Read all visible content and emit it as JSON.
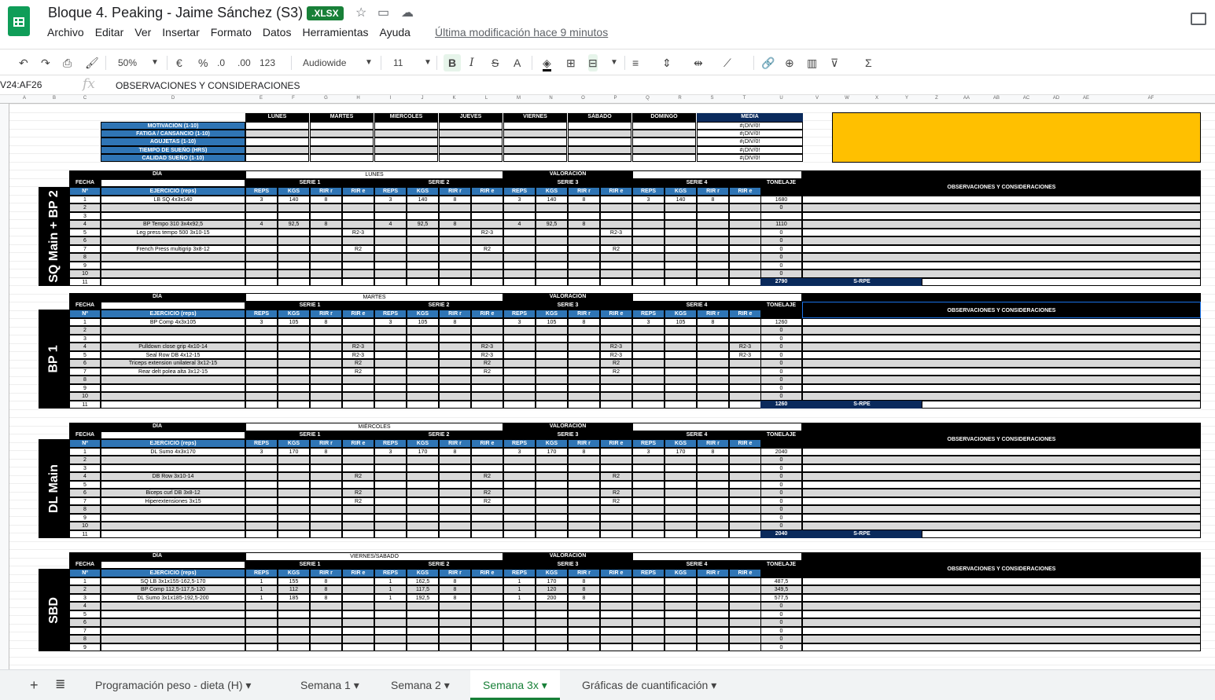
{
  "doc": {
    "title": "Bloque 4. Peaking - Jaime Sánchez (S3)",
    "badge": ".XLSX",
    "last_edit": "Última modificación hace 9 minutos"
  },
  "menu": [
    "Archivo",
    "Editar",
    "Ver",
    "Insertar",
    "Formato",
    "Datos",
    "Herramientas",
    "Ayuda"
  ],
  "toolbar": {
    "zoom": "50%",
    "currency": "€",
    "percent": "%",
    "dec_less": ".0",
    "dec_more": ".00",
    "format": "123",
    "font": "Audiowide",
    "size": "11"
  },
  "formulabar": {
    "namebox": "V24:AF26",
    "fx": "fx",
    "formula": "OBSERVACIONES Y CONSIDERACIONES"
  },
  "columns": [
    "A",
    "B",
    "C",
    "D",
    "E",
    "F",
    "G",
    "H",
    "I",
    "J",
    "K",
    "L",
    "M",
    "N",
    "O",
    "P",
    "Q",
    "R",
    "S",
    "T",
    "U",
    "V",
    "W",
    "X",
    "Y",
    "Z",
    "AA",
    "AB",
    "AC",
    "AD",
    "AE",
    "AF"
  ],
  "summary": {
    "days": [
      "LUNES",
      "MARTES",
      "MIERCOLES",
      "JUEVES",
      "VIERNES",
      "SÁBADO",
      "DOMINGO",
      "MEDIA"
    ],
    "rows": [
      "MOTIVACIÓN (1-10)",
      "FATIGA / CANSANCIO (1-10)",
      "AGUJETAS (1-10)",
      "TIEMPO DE SUEÑO (HRS)",
      "CALIDAD SUEÑO (1-10)"
    ],
    "media": "#¡DIV/0!"
  },
  "labels": {
    "dia": "DÍA",
    "fecha": "FECHA",
    "n": "Nº",
    "ejercicio": "EJERCICIO (reps)",
    "valoracion": "VALORACIÓN",
    "serie1": "SERIE 1",
    "serie2": "SERIE 2",
    "serie3": "SERIE 3",
    "serie4": "SERIE 4",
    "reps": "REPS",
    "kgs": "KGS",
    "rirr": "RIR r",
    "rire": "RIR e",
    "tonelaje": "TONELAJE",
    "obs": "OBSERVACIONES Y CONSIDERACIONES",
    "srpe": "S-RPE"
  },
  "blocks": [
    {
      "side": "SQ Main + BP 2",
      "day": "LUNES",
      "total": "2790",
      "rows": [
        {
          "n": "1",
          "ex": "LB SQ 4x3x140",
          "s": [
            [
              "3",
              "140",
              "8",
              ""
            ],
            [
              "3",
              "140",
              "8",
              ""
            ],
            [
              "3",
              "140",
              "8",
              ""
            ],
            [
              "3",
              "140",
              "8",
              ""
            ]
          ],
          "t": "1680"
        },
        {
          "n": "2",
          "ex": "",
          "s": [],
          "t": "0"
        },
        {
          "n": "3",
          "ex": "",
          "s": [],
          "t": ""
        },
        {
          "n": "4",
          "ex": "BP Tempo 310 3x4x92,5",
          "s": [
            [
              "4",
              "92,5",
              "8",
              ""
            ],
            [
              "4",
              "92,5",
              "8",
              ""
            ],
            [
              "4",
              "92,5",
              "8",
              ""
            ],
            [
              "",
              "",
              "",
              ""
            ]
          ],
          "t": "1110"
        },
        {
          "n": "5",
          "ex": "Leg press tempo 500 3x10-15",
          "s": [
            [
              "",
              "",
              "",
              "R2-3"
            ],
            [
              "",
              "",
              "",
              "R2-3"
            ],
            [
              "",
              "",
              "",
              "R2-3"
            ],
            [
              "",
              "",
              "",
              ""
            ]
          ],
          "t": "0"
        },
        {
          "n": "6",
          "ex": "",
          "s": [],
          "t": "0"
        },
        {
          "n": "7",
          "ex": "French Press multigrip 3x8-12",
          "s": [
            [
              "",
              "",
              "",
              "R2"
            ],
            [
              "",
              "",
              "",
              "R2"
            ],
            [
              "",
              "",
              "",
              "R2"
            ],
            [
              "",
              "",
              "",
              ""
            ]
          ],
          "t": "0"
        },
        {
          "n": "8",
          "ex": "",
          "s": [],
          "t": "0"
        },
        {
          "n": "9",
          "ex": "",
          "s": [],
          "t": "0"
        },
        {
          "n": "10",
          "ex": "",
          "s": [],
          "t": "0"
        },
        {
          "n": "11",
          "ex": "",
          "s": [],
          "t": "2790"
        }
      ]
    },
    {
      "side": "BP 1",
      "day": "MARTES",
      "total": "1260",
      "rows": [
        {
          "n": "1",
          "ex": "BP Comp 4x3x105",
          "s": [
            [
              "3",
              "105",
              "8",
              ""
            ],
            [
              "3",
              "105",
              "8",
              ""
            ],
            [
              "3",
              "105",
              "8",
              ""
            ],
            [
              "3",
              "105",
              "8",
              ""
            ]
          ],
          "t": "1260"
        },
        {
          "n": "2",
          "ex": "",
          "s": [],
          "t": "0"
        },
        {
          "n": "3",
          "ex": "",
          "s": [],
          "t": "0"
        },
        {
          "n": "4",
          "ex": "Pulldown close grip 4x10-14",
          "s": [
            [
              "",
              "",
              "",
              "R2-3"
            ],
            [
              "",
              "",
              "",
              "R2-3"
            ],
            [
              "",
              "",
              "",
              "R2-3"
            ],
            [
              "",
              "",
              "",
              "R2-3"
            ]
          ],
          "t": "0"
        },
        {
          "n": "5",
          "ex": "Seal Row DB 4x12-15",
          "s": [
            [
              "",
              "",
              "",
              "R2-3"
            ],
            [
              "",
              "",
              "",
              "R2-3"
            ],
            [
              "",
              "",
              "",
              "R2-3"
            ],
            [
              "",
              "",
              "",
              "R2-3"
            ]
          ],
          "t": "0"
        },
        {
          "n": "6",
          "ex": "Triceps extension unilateral 3x12-15",
          "s": [
            [
              "",
              "",
              "",
              "R2"
            ],
            [
              "",
              "",
              "",
              "R2"
            ],
            [
              "",
              "",
              "",
              "R2"
            ],
            [
              "",
              "",
              "",
              ""
            ]
          ],
          "t": "0"
        },
        {
          "n": "7",
          "ex": "Rear delt polea alta 3x12-15",
          "s": [
            [
              "",
              "",
              "",
              "R2"
            ],
            [
              "",
              "",
              "",
              "R2"
            ],
            [
              "",
              "",
              "",
              "R2"
            ],
            [
              "",
              "",
              "",
              ""
            ]
          ],
          "t": "0"
        },
        {
          "n": "8",
          "ex": "",
          "s": [],
          "t": "0"
        },
        {
          "n": "9",
          "ex": "",
          "s": [],
          "t": "0"
        },
        {
          "n": "10",
          "ex": "",
          "s": [],
          "t": "0"
        },
        {
          "n": "11",
          "ex": "",
          "s": [],
          "t": "1260"
        }
      ]
    },
    {
      "side": "DL Main",
      "day": "MIÉRCOLES",
      "total": "2040",
      "rows": [
        {
          "n": "1",
          "ex": "DL Sumo 4x3x170",
          "s": [
            [
              "3",
              "170",
              "8",
              ""
            ],
            [
              "3",
              "170",
              "8",
              ""
            ],
            [
              "3",
              "170",
              "8",
              ""
            ],
            [
              "3",
              "170",
              "8",
              ""
            ]
          ],
          "t": "2040"
        },
        {
          "n": "2",
          "ex": "",
          "s": [],
          "t": "0"
        },
        {
          "n": "3",
          "ex": "",
          "s": [],
          "t": "0"
        },
        {
          "n": "4",
          "ex": "DB Row 3x10-14",
          "s": [
            [
              "",
              "",
              "",
              "R2"
            ],
            [
              "",
              "",
              "",
              "R2"
            ],
            [
              "",
              "",
              "",
              "R2"
            ],
            [
              "",
              "",
              "",
              ""
            ]
          ],
          "t": "0"
        },
        {
          "n": "5",
          "ex": "",
          "s": [],
          "t": "0"
        },
        {
          "n": "6",
          "ex": "Biceps curl DB 3x8-12",
          "s": [
            [
              "",
              "",
              "",
              "R2"
            ],
            [
              "",
              "",
              "",
              "R2"
            ],
            [
              "",
              "",
              "",
              "R2"
            ],
            [
              "",
              "",
              "",
              ""
            ]
          ],
          "t": "0"
        },
        {
          "n": "7",
          "ex": "Hiperextensiones 3x15",
          "s": [
            [
              "",
              "",
              "",
              "R2"
            ],
            [
              "",
              "",
              "",
              "R2"
            ],
            [
              "",
              "",
              "",
              "R2"
            ],
            [
              "",
              "",
              "",
              ""
            ]
          ],
          "t": "0"
        },
        {
          "n": "8",
          "ex": "",
          "s": [],
          "t": "0"
        },
        {
          "n": "9",
          "ex": "",
          "s": [],
          "t": "0"
        },
        {
          "n": "10",
          "ex": "",
          "s": [],
          "t": "0"
        },
        {
          "n": "11",
          "ex": "",
          "s": [],
          "t": "2040"
        }
      ]
    },
    {
      "side": "SBD",
      "day": "VIERNES/SABADO",
      "total": "",
      "rows": [
        {
          "n": "1",
          "ex": "SQ LB 3x1x155-162,5-170",
          "s": [
            [
              "1",
              "155",
              "8",
              ""
            ],
            [
              "1",
              "162,5",
              "8",
              ""
            ],
            [
              "1",
              "170",
              "8",
              ""
            ],
            [
              "",
              "",
              "",
              ""
            ]
          ],
          "t": "487,5"
        },
        {
          "n": "2",
          "ex": "BP Comp 112,5-117,5-120",
          "s": [
            [
              "1",
              "112",
              "8",
              ""
            ],
            [
              "1",
              "117,5",
              "8",
              ""
            ],
            [
              "1",
              "120",
              "8",
              ""
            ],
            [
              "",
              "",
              "",
              ""
            ]
          ],
          "t": "349,5"
        },
        {
          "n": "3",
          "ex": "DL Sumo 3x1x185-192,5-200",
          "s": [
            [
              "1",
              "185",
              "8",
              ""
            ],
            [
              "1",
              "192,5",
              "8",
              ""
            ],
            [
              "1",
              "200",
              "8",
              ""
            ],
            [
              "",
              "",
              "",
              ""
            ]
          ],
          "t": "577,5"
        },
        {
          "n": "4",
          "ex": "",
          "s": [],
          "t": "0"
        },
        {
          "n": "5",
          "ex": "",
          "s": [],
          "t": "0"
        },
        {
          "n": "6",
          "ex": "",
          "s": [],
          "t": "0"
        },
        {
          "n": "7",
          "ex": "",
          "s": [],
          "t": "0"
        },
        {
          "n": "8",
          "ex": "",
          "s": [],
          "t": "0"
        },
        {
          "n": "9",
          "ex": "",
          "s": [],
          "t": "0"
        }
      ]
    }
  ],
  "sheet_tabs": [
    {
      "label": "Programación peso - dieta (H)",
      "active": false
    },
    {
      "label": "Semana 1",
      "active": false
    },
    {
      "label": "Semana 2",
      "active": false
    },
    {
      "label": "Semana 3x",
      "active": true
    },
    {
      "label": "Gráficas de cuantificación",
      "active": false
    }
  ],
  "colors": {
    "accent": "#188038",
    "header_blue": "#2f75b5",
    "orange_box": "#ffc000",
    "navy": "#0a2a5c"
  }
}
